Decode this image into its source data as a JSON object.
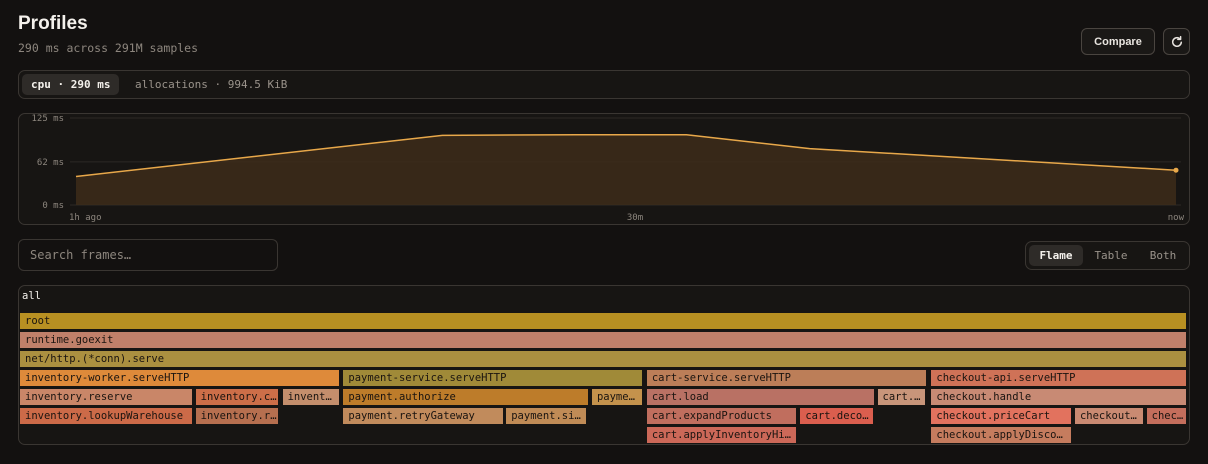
{
  "header": {
    "title": "Profiles",
    "subtitle": "290 ms across 291M samples",
    "compare_label": "Compare",
    "refresh_icon": "refresh-icon"
  },
  "metrics": [
    {
      "label": "cpu · 290 ms",
      "active": true
    },
    {
      "label": "allocations · 994.5 KiB",
      "active": false
    }
  ],
  "timeline": {
    "y_ticks": [
      "125 ms",
      "62 ms",
      "0 ms"
    ],
    "x_ticks": [
      "1h ago",
      "30m",
      "now"
    ],
    "accent": "#e8a84a"
  },
  "chart_data": {
    "type": "area",
    "x": [
      "1h ago",
      "",
      "",
      "30m",
      "",
      "now"
    ],
    "values": [
      41,
      100,
      101,
      101,
      81,
      50
    ],
    "ylim": [
      0,
      125
    ],
    "grid": true
  },
  "search": {
    "placeholder": "Search frames…"
  },
  "views": [
    {
      "label": "Flame",
      "active": true
    },
    {
      "label": "Table",
      "active": false
    },
    {
      "label": "Both",
      "active": false
    }
  ],
  "flame": {
    "root_label": "all",
    "frames": [
      {
        "label": "root",
        "color": "#b89022",
        "depth": 0,
        "start": 0,
        "width": 1
      },
      {
        "label": "runtime.goexit",
        "color": "#c0806a",
        "depth": 1,
        "start": 0,
        "width": 1
      },
      {
        "label": "net/http.(*conn).serve",
        "color": "#ab9040",
        "depth": 2,
        "start": 0,
        "width": 1
      },
      {
        "label": "inventory-worker.serveHTTP",
        "color": "#de8a3a",
        "depth": 3,
        "start": 0,
        "width": 0.2752
      },
      {
        "label": "payment-service.serveHTTP",
        "color": "#a08a38",
        "depth": 3,
        "start": 0.2769,
        "width": 0.2573
      },
      {
        "label": "cart-service.serveHTTP",
        "color": "#bc7e58",
        "depth": 3,
        "start": 0.5367,
        "width": 0.241
      },
      {
        "label": "checkout-api.serveHTTP",
        "color": "#cf7257",
        "depth": 3,
        "start": 0.7803,
        "width": 0.2197
      },
      {
        "label": "inventory.reserve",
        "color": "#c98668",
        "depth": 4,
        "start": 0,
        "width": 0.1487
      },
      {
        "label": "inventory.c…",
        "color": "#cc6e48",
        "depth": 4,
        "start": 0.1504,
        "width": 0.0726
      },
      {
        "label": "invent…",
        "color": "#c48e6c",
        "depth": 4,
        "start": 0.2248,
        "width": 0.0504
      },
      {
        "label": "payment.authorize",
        "color": "#bd7c2a",
        "depth": 4,
        "start": 0.2769,
        "width": 0.2111
      },
      {
        "label": "payme…",
        "color": "#c4924c",
        "depth": 4,
        "start": 0.4897,
        "width": 0.0444
      },
      {
        "label": "cart.load",
        "color": "#b97164",
        "depth": 4,
        "start": 0.5367,
        "width": 0.1958
      },
      {
        "label": "cart.…",
        "color": "#c8957a",
        "depth": 4,
        "start": 0.7342,
        "width": 0.0427
      },
      {
        "label": "checkout.handle",
        "color": "#c88a74",
        "depth": 4,
        "start": 0.7803,
        "width": 0.2197
      },
      {
        "label": "inventory.lookupWarehouse",
        "color": "#cc6a48",
        "depth": 5,
        "start": 0,
        "width": 0.1487
      },
      {
        "label": "inventory.r…",
        "color": "#b66f4f",
        "depth": 5,
        "start": 0.1504,
        "width": 0.0726
      },
      {
        "label": "payment.retryGateway",
        "color": "#c18b5c",
        "depth": 5,
        "start": 0.2769,
        "width": 0.1381
      },
      {
        "label": "payment.si…",
        "color": "#c08b56",
        "depth": 5,
        "start": 0.4163,
        "width": 0.07
      },
      {
        "label": "cart.expandProducts",
        "color": "#c06e5e",
        "depth": 5,
        "start": 0.5367,
        "width": 0.1297
      },
      {
        "label": "cart.deco…",
        "color": "#db5e4e",
        "depth": 5,
        "start": 0.6681,
        "width": 0.0641
      },
      {
        "label": "checkout.priceCart",
        "color": "#e2725e",
        "depth": 5,
        "start": 0.7803,
        "width": 0.1213
      },
      {
        "label": "checkout…",
        "color": "#c98a72",
        "depth": 5,
        "start": 0.9032,
        "width": 0.0598
      },
      {
        "label": "chec…",
        "color": "#c46e5c",
        "depth": 5,
        "start": 0.9646,
        "width": 0.0354
      },
      {
        "label": "cart.applyInventoryHi…",
        "color": "#cc6858",
        "depth": 6,
        "start": 0.5367,
        "width": 0.1297
      },
      {
        "label": "checkout.applyDisco…",
        "color": "#c57c5e",
        "depth": 6,
        "start": 0.7803,
        "width": 0.1213
      }
    ]
  }
}
